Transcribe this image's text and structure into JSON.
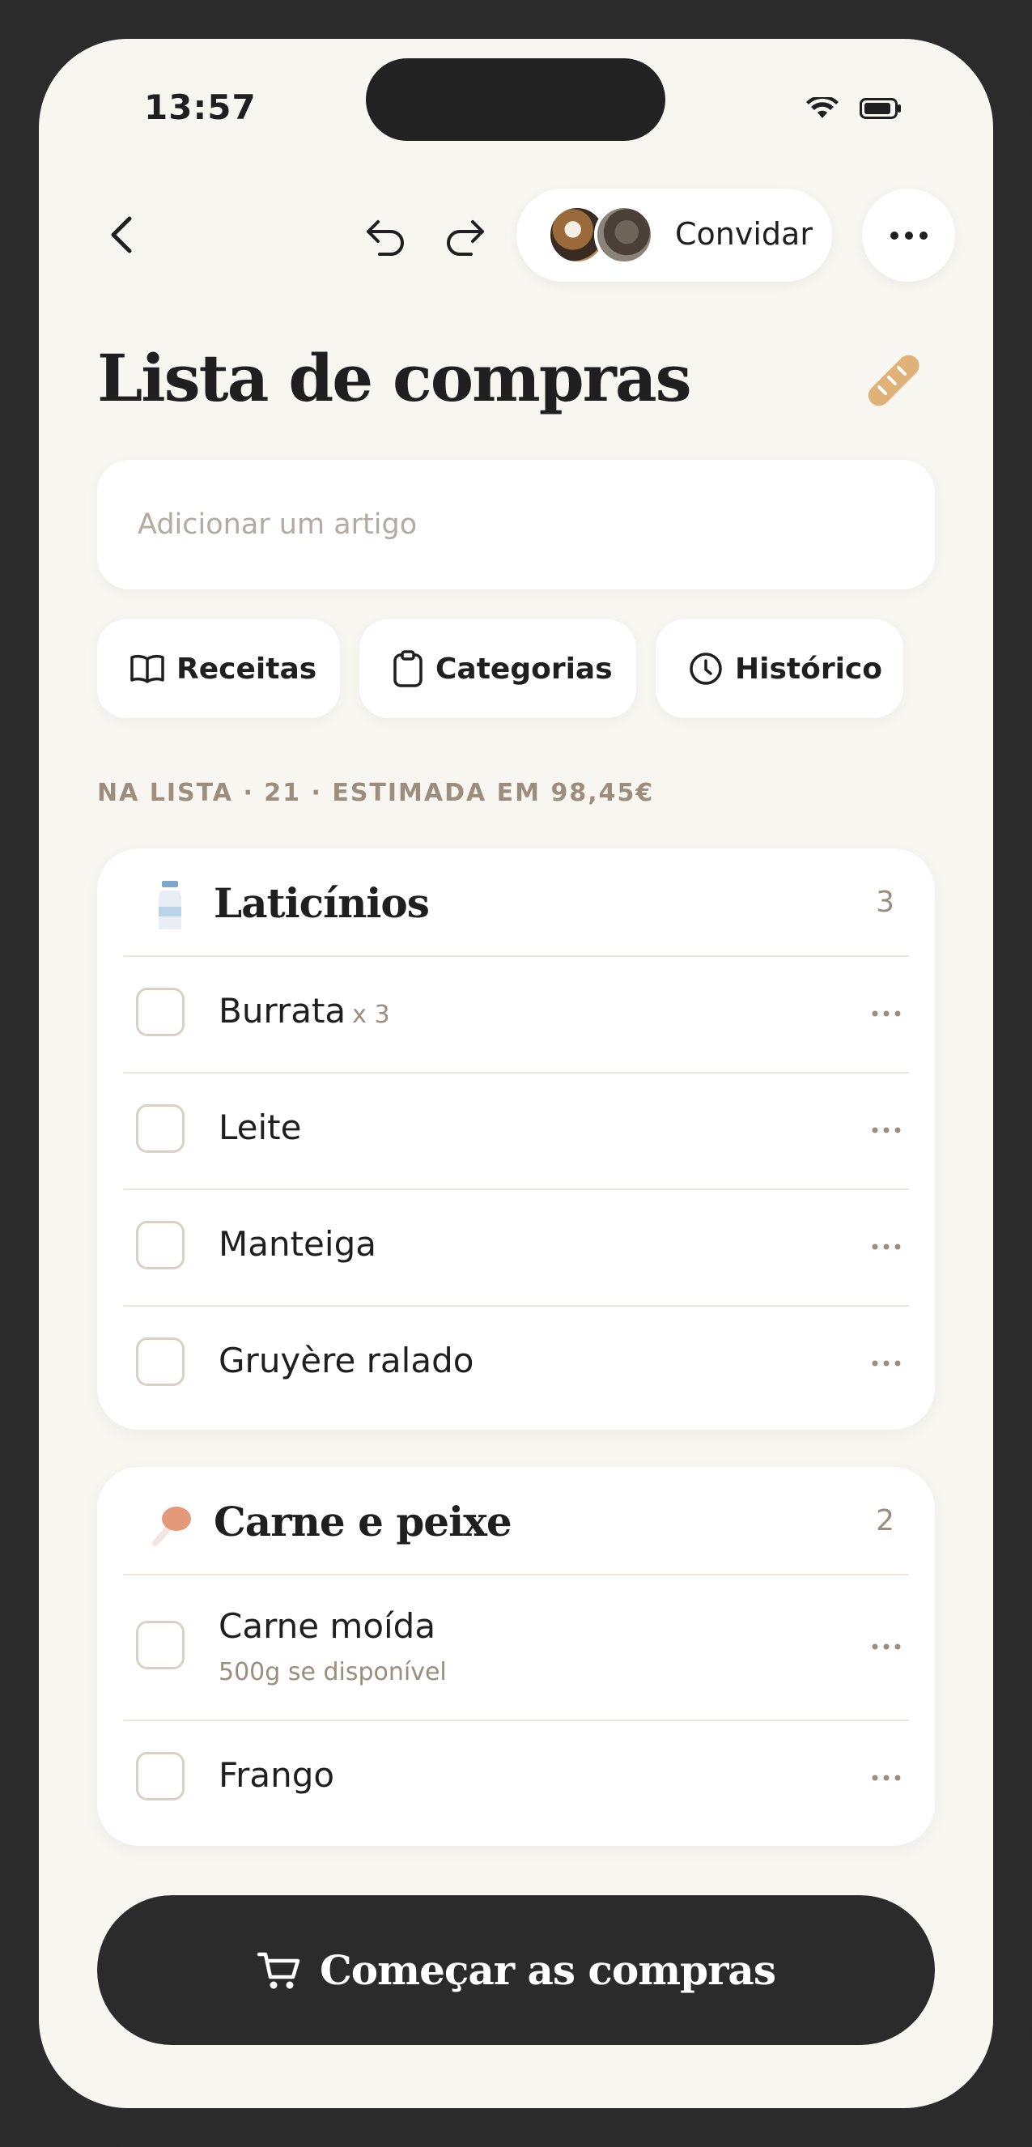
{
  "status_bar": {
    "time": "13:57"
  },
  "toolbar": {
    "invite_label": "Convidar"
  },
  "title": "Lista de compras",
  "add_item": {
    "placeholder": "Adicionar um artigo"
  },
  "chips": [
    {
      "label": "Receitas",
      "icon": "book-icon"
    },
    {
      "label": "Categorias",
      "icon": "clipboard-icon"
    },
    {
      "label": "Histórico",
      "icon": "clock-icon"
    }
  ],
  "summary": "NA LISTA · 21 · ESTIMADA EM 98,45€",
  "categories": [
    {
      "name": "Laticínios",
      "count": "3",
      "icon": "milk-bottle-icon",
      "items": [
        {
          "name": "Burrata",
          "qty": "x 3"
        },
        {
          "name": "Leite"
        },
        {
          "name": "Manteiga"
        },
        {
          "name": "Gruyère ralado"
        }
      ]
    },
    {
      "name": "Carne e peixe",
      "count": "2",
      "icon": "meat-drumstick-icon",
      "items": [
        {
          "name": "Carne moída",
          "note": "500g se disponível"
        },
        {
          "name": "Frango"
        }
      ]
    }
  ],
  "start_button": {
    "label": "Começar as compras"
  },
  "colors": {
    "background": "#f8f6f1",
    "dark": "#2b2b2b",
    "muted": "#9c8d7c",
    "accent": "#e0b27a"
  }
}
